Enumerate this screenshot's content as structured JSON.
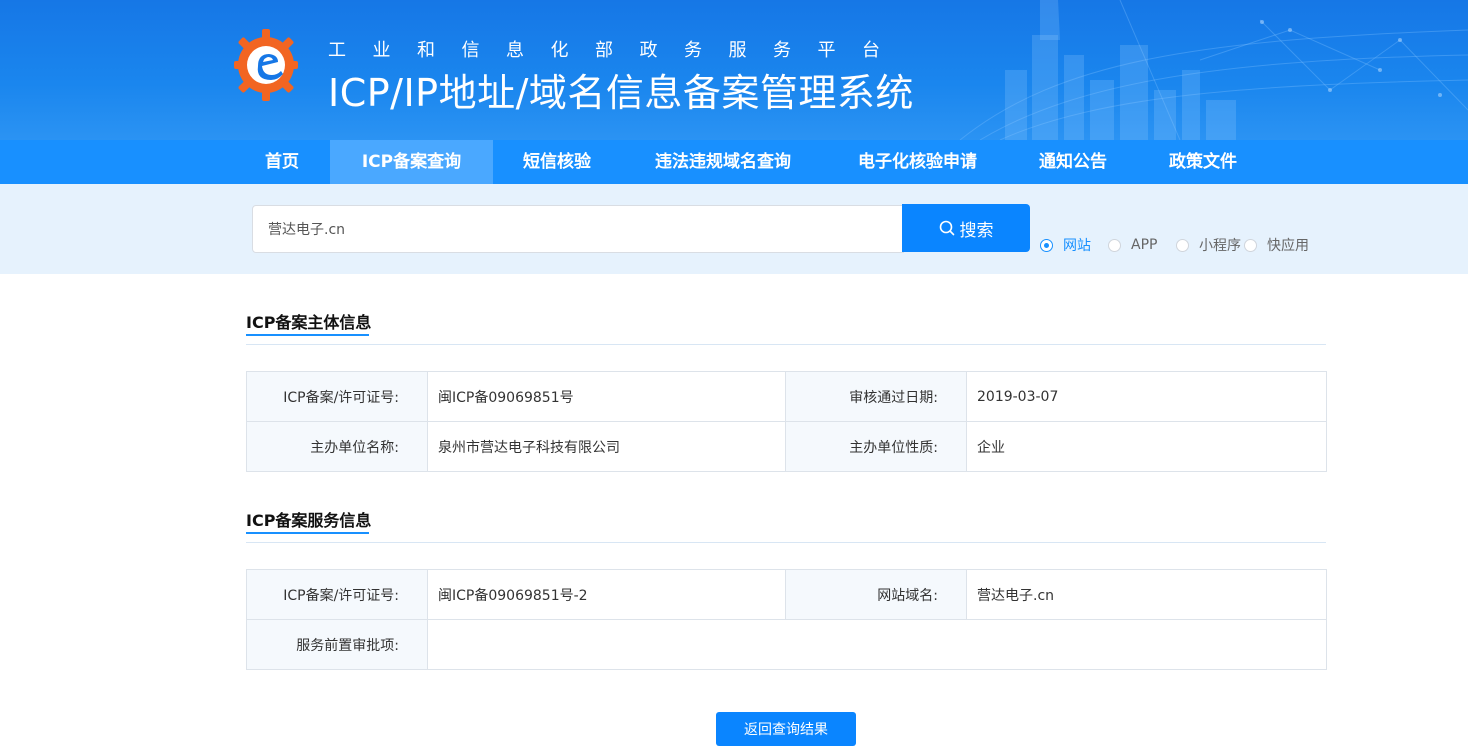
{
  "header": {
    "subtitle": "工业和信息化部政务服务平台",
    "title": "ICP/IP地址/域名信息备案管理系统"
  },
  "nav": {
    "items": [
      {
        "label": "首页"
      },
      {
        "label": "ICP备案查询",
        "active": true
      },
      {
        "label": "短信核验"
      },
      {
        "label": "违法违规域名查询"
      },
      {
        "label": "电子化核验申请"
      },
      {
        "label": "通知公告"
      },
      {
        "label": "政策文件"
      }
    ]
  },
  "search": {
    "value": "营达电子.cn",
    "button_label": "搜索",
    "icon": "search-icon",
    "options": [
      {
        "label": "网站",
        "checked": true
      },
      {
        "label": "APP",
        "checked": false
      },
      {
        "label": "小程序",
        "checked": false
      },
      {
        "label": "快应用",
        "checked": false
      }
    ]
  },
  "subject_section": {
    "title": "ICP备案主体信息",
    "rows": [
      [
        "ICP备案/许可证号:",
        "闽ICP备09069851号",
        "审核通过日期:",
        "2019-03-07"
      ],
      [
        "主办单位名称:",
        "泉州市营达电子科技有限公司",
        "主办单位性质:",
        "企业"
      ]
    ]
  },
  "service_section": {
    "title": "ICP备案服务信息",
    "rows": [
      [
        "ICP备案/许可证号:",
        "闽ICP备09069851号-2",
        "网站域名:",
        "营达电子.cn"
      ],
      [
        "服务前置审批项:",
        ""
      ]
    ]
  },
  "back_button_label": "返回查询结果",
  "colors": {
    "primary": "#1890ff",
    "nav_active": "#4aa8ff",
    "search_band": "#e6f2fd",
    "logo_orange": "#f26522"
  }
}
